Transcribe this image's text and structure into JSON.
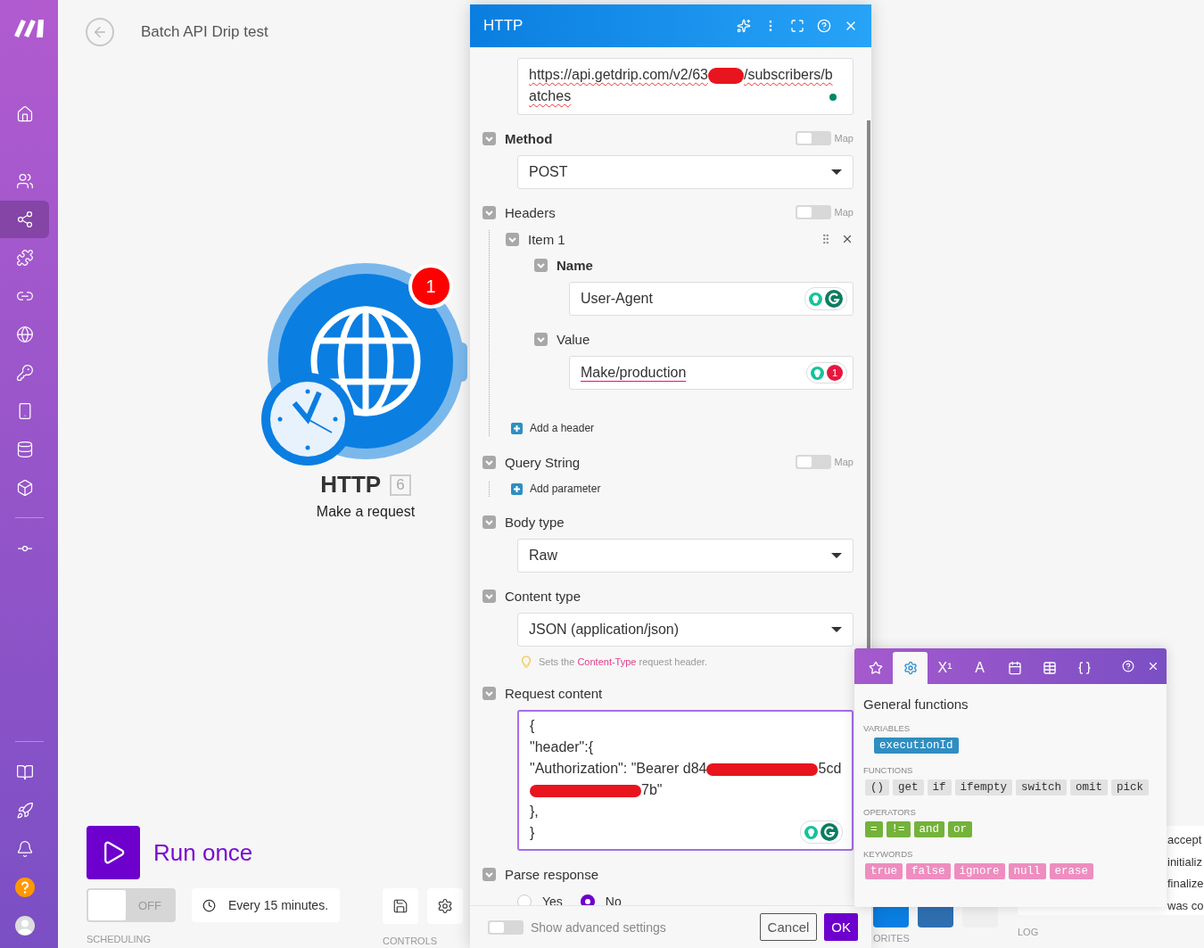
{
  "sidebar": {
    "items": [
      {
        "selected": false
      },
      {
        "selected": false
      },
      {
        "selected": true
      },
      {
        "selected": false
      },
      {
        "selected": false
      },
      {
        "selected": false
      },
      {
        "selected": false
      },
      {
        "selected": false
      },
      {
        "selected": false
      },
      {
        "selected": false
      },
      {
        "selected": false
      }
    ]
  },
  "scenario": {
    "title": "Batch API Drip test"
  },
  "module": {
    "name": "HTTP",
    "id": "6",
    "action": "Make a request",
    "badge": "1"
  },
  "run": {
    "label": "Run once"
  },
  "scheduling": {
    "label": "SCHEDULING",
    "toggle": {
      "on": false,
      "text": "OFF"
    },
    "interval": "Every 15 minutes."
  },
  "controls": {
    "label": "CONTROLS"
  },
  "favorites": {
    "label": "ORITES"
  },
  "log": {
    "label": "LOG",
    "rows": [
      "accept",
      "initializ",
      "finalize",
      "was co"
    ]
  },
  "dialog": {
    "title": "HTTP",
    "fields": [
      {
        "kind": "url",
        "lines": [
          [
            {
              "kind": "text",
              "text": "https://api.getdrip.com/v2/63"
            },
            {
              "kind": "redacted"
            },
            {
              "kind": "text",
              "text": "/subscribers/b"
            }
          ],
          [
            {
              "kind": "text",
              "text": "atches"
            }
          ]
        ]
      },
      {
        "kind": "select",
        "label": "Method",
        "map": {
          "label": "Map",
          "on": false
        },
        "value": "POST"
      },
      {
        "kind": "array",
        "label": "Headers",
        "map": {
          "label": "Map",
          "on": false
        },
        "add_label": "Add a header",
        "items": [
          {
            "label": "Item 1",
            "fields": [
              {
                "label": "Name",
                "value": "User-Agent",
                "assist": {
                  "kind": "ok"
                }
              },
              {
                "label": "Value",
                "value": "Make/production",
                "assist": {
                  "kind": "issues",
                  "count": "1"
                }
              }
            ]
          }
        ]
      },
      {
        "kind": "array",
        "label": "Query String",
        "map": {
          "label": "Map",
          "on": false
        },
        "add_label": "Add parameter"
      },
      {
        "kind": "select",
        "label": "Body type",
        "value": "Raw"
      },
      {
        "kind": "select",
        "label": "Content type",
        "value": "JSON (application/json)",
        "hint": {
          "before": "Sets the ",
          "highlight": "Content-Type",
          "after": " request header."
        }
      },
      {
        "kind": "textarea",
        "label": "Request content",
        "lines": [
          [
            {
              "kind": "text",
              "text": "{"
            }
          ],
          [
            {
              "kind": "text",
              "text": "\"header\":{"
            }
          ],
          [
            {
              "kind": "text",
              "text": "\"Authorization\": \"Bearer d84"
            },
            {
              "kind": "redacted"
            },
            {
              "kind": "text",
              "text": "5cd"
            }
          ],
          [
            {
              "kind": "redacted"
            },
            {
              "kind": "text",
              "text": "7b\""
            }
          ],
          [
            {
              "kind": "text",
              "text": "},"
            }
          ],
          [
            {
              "kind": "text",
              "text": "}"
            }
          ]
        ],
        "assist": {
          "kind": "ok"
        }
      },
      {
        "kind": "radio",
        "label": "Parse response",
        "options": [
          {
            "label": "Yes",
            "selected": false
          },
          {
            "label": "No",
            "selected": true
          }
        ]
      }
    ],
    "advanced": {
      "label": "Show advanced settings",
      "on": false
    },
    "buttons": [
      {
        "kind": "secondary",
        "label": "Cancel"
      },
      {
        "kind": "primary",
        "label": "OK"
      }
    ]
  },
  "functions": {
    "tabs": [
      {
        "selected": false
      },
      {
        "selected": true
      },
      {
        "label": "X¹",
        "selected": false
      },
      {
        "label": "A",
        "selected": false
      },
      {
        "selected": false
      },
      {
        "selected": false
      },
      {
        "selected": false
      }
    ],
    "title": "General functions",
    "groups": [
      {
        "label": "VARIABLES",
        "kind": "variable",
        "items": [
          "executionId"
        ]
      },
      {
        "label": "FUNCTIONS",
        "kind": "function",
        "items": [
          "()",
          "get",
          "if",
          "ifempty",
          "switch",
          "omit",
          "pick"
        ]
      },
      {
        "label": "OPERATORS",
        "kind": "operator",
        "items": [
          "=",
          "!=",
          "and",
          "or"
        ]
      },
      {
        "label": "KEYWORDS",
        "kind": "keyword",
        "items": [
          "true",
          "false",
          "ignore",
          "null",
          "erase"
        ]
      }
    ]
  }
}
